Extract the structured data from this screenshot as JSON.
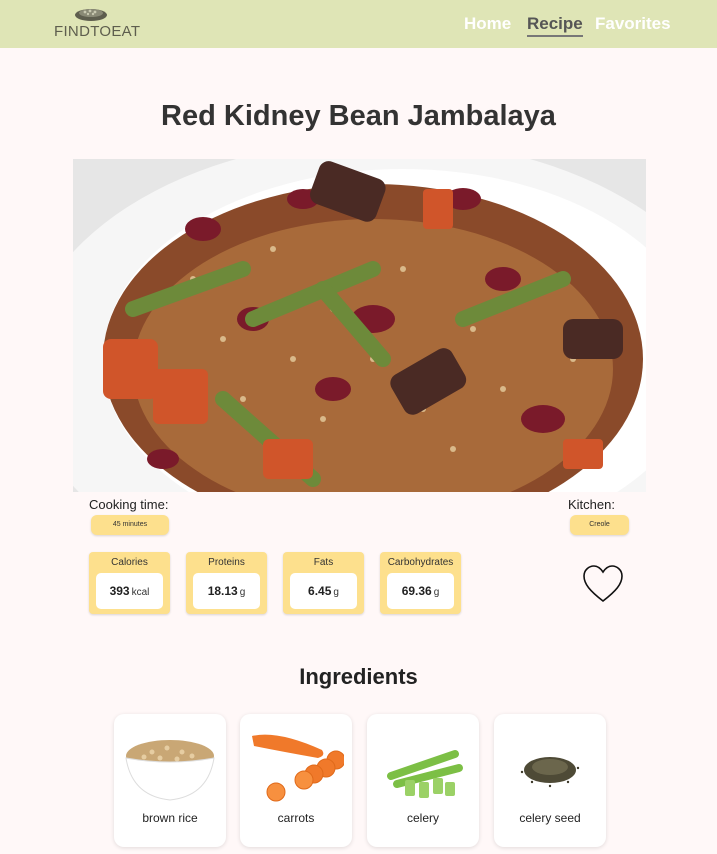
{
  "nav": {
    "logo_text": "FINDTOEAT",
    "links": [
      {
        "label": "Home",
        "active": false
      },
      {
        "label": "Recipe",
        "active": true
      },
      {
        "label": "Favorites",
        "active": false
      }
    ]
  },
  "recipe": {
    "title": "Red Kidney Bean Jambalaya",
    "cooking_time_label": "Cooking time:",
    "cooking_time_value": "45 minutes",
    "kitchen_label": "Kitchen:",
    "kitchen_value": "Creole",
    "nutrition": [
      {
        "name": "Calories",
        "value": "393",
        "unit": "kcal"
      },
      {
        "name": "Proteins",
        "value": "18.13",
        "unit": "g"
      },
      {
        "name": "Fats",
        "value": "6.45",
        "unit": "g"
      },
      {
        "name": "Carbohydrates",
        "value": "69.36",
        "unit": "g"
      }
    ],
    "favorite": false
  },
  "ingredients": {
    "title": "Ingredients",
    "items": [
      {
        "name": "brown rice",
        "icon": "brown-rice-image"
      },
      {
        "name": "carrots",
        "icon": "carrots-image"
      },
      {
        "name": "celery",
        "icon": "celery-image"
      },
      {
        "name": "celery seed",
        "icon": "celery-seed-image"
      }
    ]
  },
  "colors": {
    "navbar": "#dfe5b6",
    "accent": "#fde08d",
    "background": "#fff8f8"
  }
}
